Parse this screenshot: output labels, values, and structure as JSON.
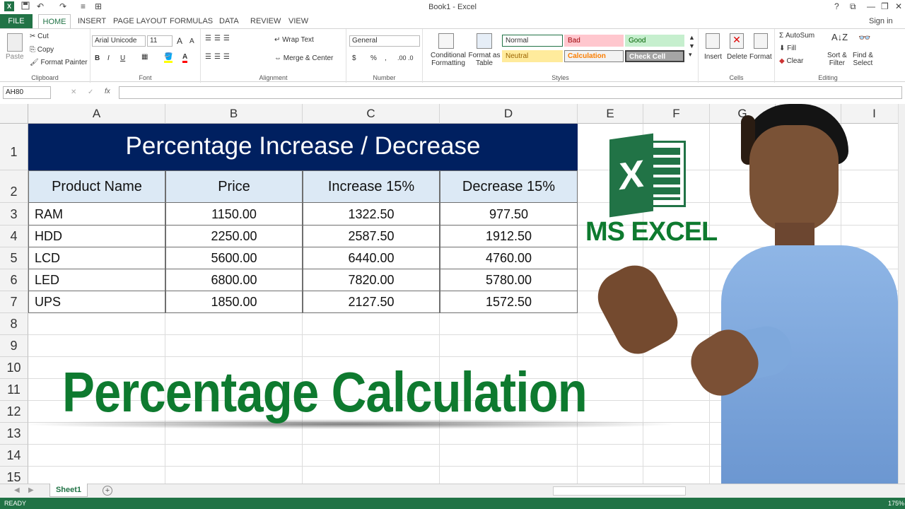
{
  "window": {
    "title": "Book1 - Excel",
    "signin": "Sign in"
  },
  "quick_access": {
    "save_icon": "save-icon",
    "undo_icon": "undo-icon",
    "redo_icon": "redo-icon"
  },
  "tabs": [
    "FILE",
    "HOME",
    "INSERT",
    "PAGE LAYOUT",
    "FORMULAS",
    "DATA",
    "REVIEW",
    "VIEW"
  ],
  "ribbon": {
    "clipboard": {
      "paste": "Paste",
      "cut": "Cut",
      "copy": "Copy",
      "format_painter": "Format Painter",
      "label": "Clipboard"
    },
    "font": {
      "name": "Arial Unicode",
      "size": "11",
      "bold": "B",
      "italic": "I",
      "underline": "U",
      "grow": "A",
      "shrink": "A",
      "label": "Font"
    },
    "alignment": {
      "wrap_text": "Wrap Text",
      "merge_center": "Merge & Center",
      "label": "Alignment"
    },
    "number": {
      "format": "General",
      "currency": "$",
      "percent": "%",
      "comma": ",",
      "label": "Number"
    },
    "styles": {
      "conditional": "Conditional",
      "formatting": "Formatting",
      "format_as": "Format as",
      "table": "Table",
      "normal": "Normal",
      "bad": "Bad",
      "good": "Good",
      "neutral": "Neutral",
      "calculation": "Calculation",
      "check_cell": "Check Cell",
      "label": "Styles"
    },
    "cells": {
      "insert": "Insert",
      "delete": "Delete",
      "format": "Format",
      "label": "Cells"
    },
    "editing": {
      "autosum": "AutoSum",
      "fill": "Fill",
      "clear": "Clear",
      "sort": "Sort &",
      "filter": "Filter",
      "find": "Find &",
      "select": "Select",
      "label": "Editing"
    }
  },
  "formula_bar": {
    "name_box": "AH80",
    "cancel": "✕",
    "enter": "✓",
    "fx": "fx",
    "value": ""
  },
  "columns": [
    "A",
    "B",
    "C",
    "D",
    "E",
    "F",
    "G",
    "H",
    "I"
  ],
  "rows": [
    "1",
    "2",
    "3",
    "4",
    "5",
    "6",
    "7",
    "8",
    "9",
    "10",
    "11",
    "12",
    "13",
    "14",
    "15"
  ],
  "table": {
    "title": "Percentage Increase / Decrease",
    "headers": [
      "Product Name",
      "Price",
      "Increase 15%",
      "Decrease 15%"
    ],
    "rows": [
      [
        "RAM",
        "1150.00",
        "1322.50",
        "977.50"
      ],
      [
        "HDD",
        "2250.00",
        "2587.50",
        "1912.50"
      ],
      [
        "LCD",
        "5600.00",
        "6440.00",
        "4760.00"
      ],
      [
        "LED",
        "6800.00",
        "7820.00",
        "5780.00"
      ],
      [
        "UPS",
        "1850.00",
        "2127.50",
        "1572.50"
      ]
    ]
  },
  "overlay": {
    "headline": "Percentage Calculation",
    "logo_text": "MS EXCEL",
    "logo_letter": "X"
  },
  "sheets": {
    "active": "Sheet1",
    "add": "+"
  },
  "status": {
    "ready": "READY",
    "zoom": "175%"
  },
  "colors": {
    "excel_green": "#217346",
    "title_navy": "#002060",
    "header_blue": "#dce9f5",
    "headline_green": "#0e7a2f"
  }
}
